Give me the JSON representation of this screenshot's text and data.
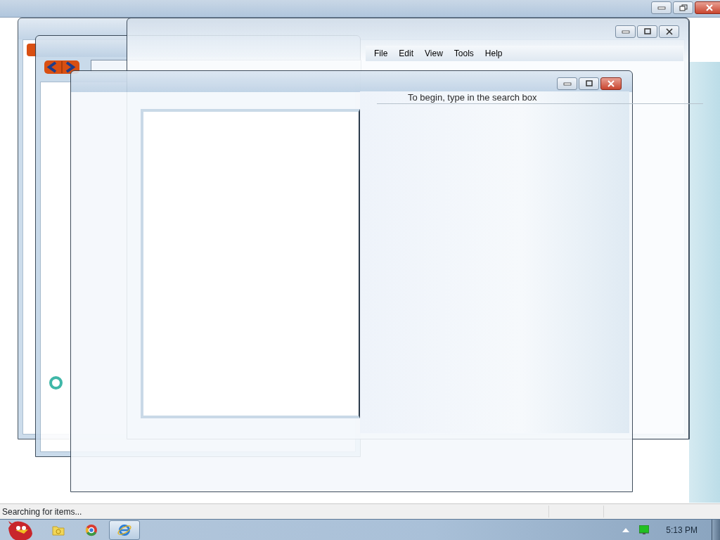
{
  "menu": [
    "File",
    "Edit",
    "View",
    "Tools",
    "Help"
  ],
  "hint": "To begin, type in the search box",
  "status_bar": {
    "text": "Searching for items..."
  },
  "taskbar": {
    "apps": [
      {
        "kind": "folder",
        "selected": false
      },
      {
        "kind": "chrome",
        "selected": false
      },
      {
        "kind": "ie",
        "selected": true
      }
    ],
    "clock": "5:13 PM"
  }
}
